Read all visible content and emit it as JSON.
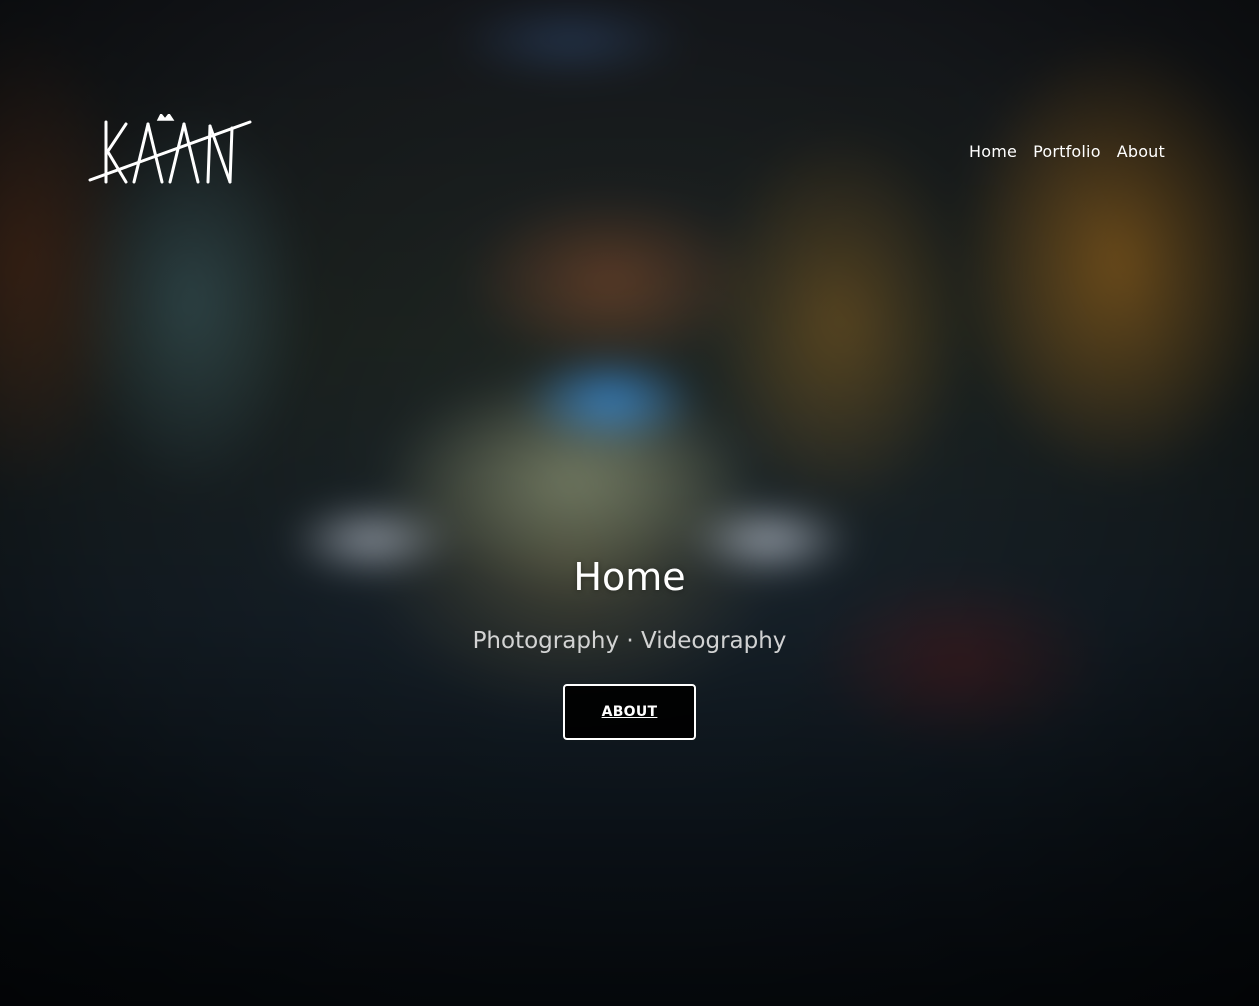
{
  "header": {
    "logo_text": "KAAN",
    "nav": [
      {
        "label": "Home"
      },
      {
        "label": "Portfolio"
      },
      {
        "label": "About"
      }
    ]
  },
  "hero": {
    "title": "Home",
    "subtitle": "Photography · Videography",
    "button_label": "ABOUT"
  },
  "colors": {
    "text": "#ffffff",
    "button_bg": "#000000",
    "button_border": "#ffffff"
  }
}
